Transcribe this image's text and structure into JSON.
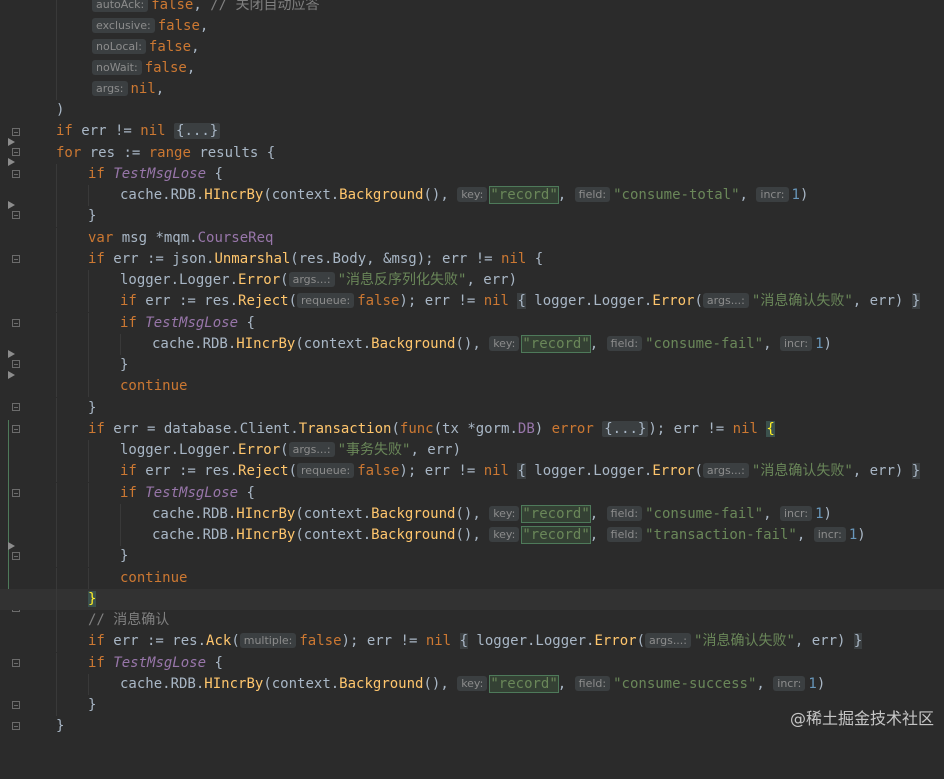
{
  "editor": {
    "language": "Go",
    "hint_labels": {
      "autoAck": "autoAck:",
      "exclusive": "exclusive:",
      "noLocal": "noLocal:",
      "noWait": "noWait:",
      "args": "args:",
      "key": "key:",
      "field": "field:",
      "incr": "incr:",
      "args_variadic": "args...:",
      "requeue": "requeue:",
      "multiple": "multiple:"
    },
    "strings": {
      "comment_autoack": "// 关闭自动应答",
      "record": "\"record\"",
      "consume_total": "\"consume-total\"",
      "consume_fail": "\"consume-fail\"",
      "transaction_fail": "\"transaction-fail\"",
      "consume_success": "\"consume-success\"",
      "unmarshal_fail": "\"消息反序列化失败\"",
      "confirm_fail": "\"消息确认失败\"",
      "tx_fail": "\"事务失败\"",
      "comment_ack": "// 消息确认"
    },
    "numbers": {
      "one": "1"
    },
    "folded": {
      "nil_block": "{...}",
      "func_block": "{...}"
    }
  },
  "watermark": "@稀土掘金技术社区",
  "colors": {
    "background": "#2b2b2b",
    "keyword": "#cc7832",
    "string": "#6a8759",
    "number": "#6897bb",
    "function": "#ffc66d",
    "constant": "#9876aa",
    "comment": "#808080",
    "default_text": "#a9b7c6"
  }
}
